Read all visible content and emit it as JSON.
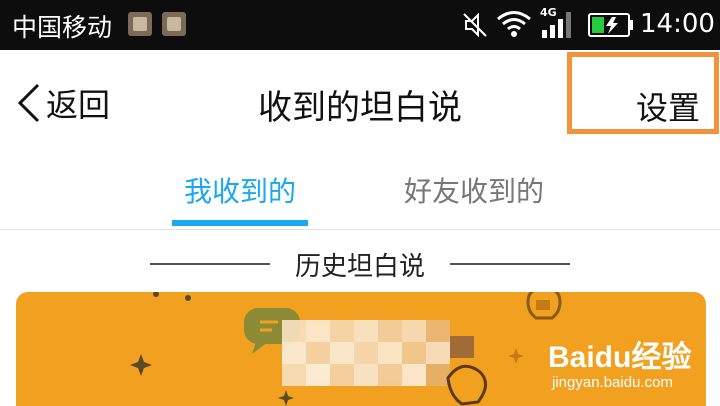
{
  "status_bar": {
    "carrier": "中国移动",
    "network": "4G",
    "time": "14:00",
    "icons": [
      "notification-app-icon",
      "gallery-icon",
      "mute-icon",
      "wifi-icon",
      "signal-icon",
      "battery-charging-icon"
    ]
  },
  "nav": {
    "back_label": "返回",
    "title": "收到的坦白说",
    "settings_label": "设置",
    "highlight_color": "#f0933a"
  },
  "tabs": [
    {
      "label": "我收到的",
      "active": true
    },
    {
      "label": "好友收到的",
      "active": false
    }
  ],
  "section": {
    "title": "历史坦白说"
  },
  "card": {
    "color": "#f1a020"
  },
  "watermark": {
    "brand": "Baidu经验",
    "url": "jingyan.baidu.com"
  },
  "accent_color": "#1aa8f0"
}
